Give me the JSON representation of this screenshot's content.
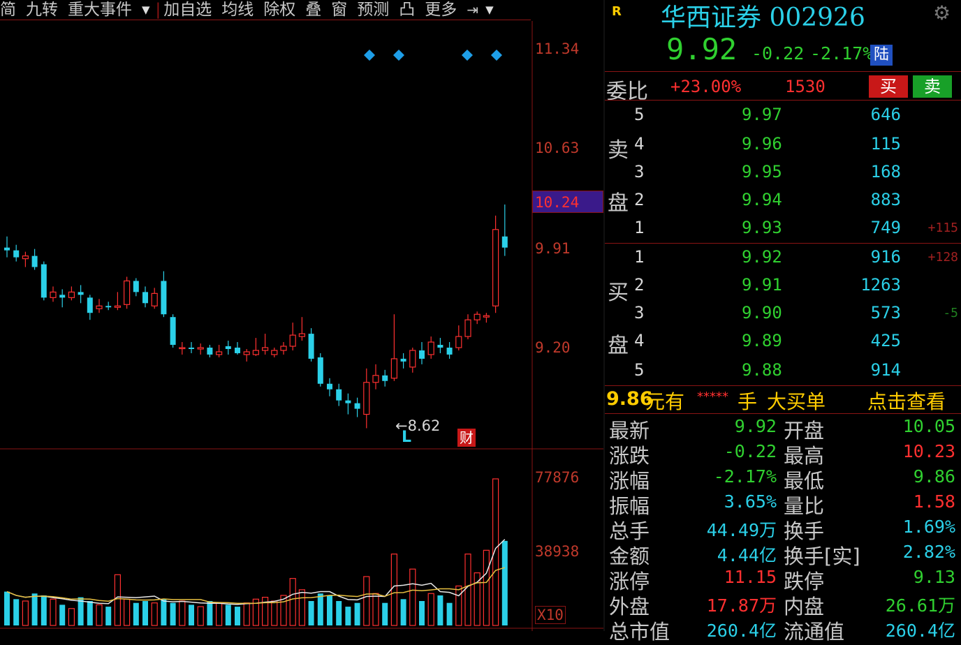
{
  "toolbar": {
    "items": [
      "简",
      "九转",
      "重大事件",
      "加自选",
      "均线",
      "除权",
      "叠",
      "窗",
      "预测",
      "凸",
      "更多"
    ]
  },
  "axis": {
    "price_ticks": [
      "11.34",
      "10.63",
      "9.91",
      "9.20"
    ],
    "highlight_price": "10.24",
    "volume_ticks": [
      "77876",
      "38938"
    ],
    "volume_unit": "X10"
  },
  "annotations": {
    "low_label": "←8.62",
    "low_marker": "L",
    "cai_marker": "财"
  },
  "colors": {
    "up": "#ff3030",
    "down": "#2bd0e8",
    "bg": "#000000",
    "accent": "#ffcc00"
  },
  "chart_data": {
    "type": "candlestick",
    "candles": [
      {
        "o": 9.92,
        "h": 10.0,
        "l": 9.85,
        "c": 9.9
      },
      {
        "o": 9.9,
        "h": 9.94,
        "l": 9.82,
        "c": 9.85
      },
      {
        "o": 9.84,
        "h": 9.89,
        "l": 9.78,
        "c": 9.86
      },
      {
        "o": 9.86,
        "h": 9.91,
        "l": 9.76,
        "c": 9.78
      },
      {
        "o": 9.8,
        "h": 9.82,
        "l": 9.54,
        "c": 9.56
      },
      {
        "o": 9.56,
        "h": 9.64,
        "l": 9.53,
        "c": 9.6
      },
      {
        "o": 9.58,
        "h": 9.62,
        "l": 9.49,
        "c": 9.56
      },
      {
        "o": 9.56,
        "h": 9.64,
        "l": 9.54,
        "c": 9.6
      },
      {
        "o": 9.6,
        "h": 9.65,
        "l": 9.52,
        "c": 9.58
      },
      {
        "o": 9.56,
        "h": 9.58,
        "l": 9.4,
        "c": 9.45
      },
      {
        "o": 9.48,
        "h": 9.55,
        "l": 9.45,
        "c": 9.5
      },
      {
        "o": 9.5,
        "h": 9.53,
        "l": 9.47,
        "c": 9.49
      },
      {
        "o": 9.49,
        "h": 9.6,
        "l": 9.47,
        "c": 9.5
      },
      {
        "o": 9.51,
        "h": 9.71,
        "l": 9.48,
        "c": 9.68
      },
      {
        "o": 9.68,
        "h": 9.7,
        "l": 9.57,
        "c": 9.6
      },
      {
        "o": 9.6,
        "h": 9.64,
        "l": 9.49,
        "c": 9.52
      },
      {
        "o": 9.5,
        "h": 9.63,
        "l": 9.48,
        "c": 9.59
      },
      {
        "o": 9.68,
        "h": 9.75,
        "l": 9.42,
        "c": 9.44
      },
      {
        "o": 9.42,
        "h": 9.44,
        "l": 9.2,
        "c": 9.22
      },
      {
        "o": 9.2,
        "h": 9.24,
        "l": 9.15,
        "c": 9.2
      },
      {
        "o": 9.2,
        "h": 9.24,
        "l": 9.16,
        "c": 9.19
      },
      {
        "o": 9.19,
        "h": 9.23,
        "l": 9.15,
        "c": 9.2
      },
      {
        "o": 9.2,
        "h": 9.22,
        "l": 9.13,
        "c": 9.15
      },
      {
        "o": 9.15,
        "h": 9.22,
        "l": 9.13,
        "c": 9.17
      },
      {
        "o": 9.21,
        "h": 9.25,
        "l": 9.15,
        "c": 9.19
      },
      {
        "o": 9.2,
        "h": 9.24,
        "l": 9.15,
        "c": 9.16
      },
      {
        "o": 9.15,
        "h": 9.19,
        "l": 9.1,
        "c": 9.17
      },
      {
        "o": 9.15,
        "h": 9.27,
        "l": 9.14,
        "c": 9.18
      },
      {
        "o": 9.18,
        "h": 9.3,
        "l": 9.15,
        "c": 9.2
      },
      {
        "o": 9.15,
        "h": 9.2,
        "l": 9.13,
        "c": 9.18
      },
      {
        "o": 9.18,
        "h": 9.24,
        "l": 9.15,
        "c": 9.21
      },
      {
        "o": 9.21,
        "h": 9.38,
        "l": 9.18,
        "c": 9.29
      },
      {
        "o": 9.28,
        "h": 9.42,
        "l": 9.25,
        "c": 9.3
      },
      {
        "o": 9.3,
        "h": 9.34,
        "l": 9.1,
        "c": 9.12
      },
      {
        "o": 9.13,
        "h": 9.16,
        "l": 8.92,
        "c": 8.94
      },
      {
        "o": 8.94,
        "h": 8.98,
        "l": 8.85,
        "c": 8.9
      },
      {
        "o": 8.9,
        "h": 8.94,
        "l": 8.78,
        "c": 8.82
      },
      {
        "o": 8.82,
        "h": 8.87,
        "l": 8.72,
        "c": 8.8
      },
      {
        "o": 8.8,
        "h": 8.84,
        "l": 8.7,
        "c": 8.76
      },
      {
        "o": 8.72,
        "h": 9.05,
        "l": 8.62,
        "c": 8.95
      },
      {
        "o": 8.95,
        "h": 9.08,
        "l": 8.9,
        "c": 9.0
      },
      {
        "o": 9.0,
        "h": 9.04,
        "l": 8.92,
        "c": 8.96
      },
      {
        "o": 8.98,
        "h": 9.44,
        "l": 8.96,
        "c": 9.12
      },
      {
        "o": 9.12,
        "h": 9.16,
        "l": 9.05,
        "c": 9.1
      },
      {
        "o": 9.06,
        "h": 9.2,
        "l": 9.02,
        "c": 9.18
      },
      {
        "o": 9.18,
        "h": 9.24,
        "l": 9.08,
        "c": 9.12
      },
      {
        "o": 9.15,
        "h": 9.28,
        "l": 9.12,
        "c": 9.24
      },
      {
        "o": 9.22,
        "h": 9.27,
        "l": 9.16,
        "c": 9.2
      },
      {
        "o": 9.2,
        "h": 9.24,
        "l": 9.12,
        "c": 9.15
      },
      {
        "o": 9.2,
        "h": 9.36,
        "l": 9.18,
        "c": 9.28
      },
      {
        "o": 9.28,
        "h": 9.44,
        "l": 9.26,
        "c": 9.4
      },
      {
        "o": 9.4,
        "h": 9.46,
        "l": 9.37,
        "c": 9.44
      },
      {
        "o": 9.42,
        "h": 9.45,
        "l": 9.38,
        "c": 9.43
      },
      {
        "o": 9.5,
        "h": 10.15,
        "l": 9.45,
        "c": 10.05
      },
      {
        "o": 10.0,
        "h": 10.23,
        "l": 9.86,
        "c": 9.92
      }
    ],
    "volumes": [
      18000,
      14000,
      13000,
      17000,
      16000,
      14000,
      11000,
      9000,
      15000,
      13000,
      11000,
      10000,
      27000,
      14000,
      12000,
      13000,
      12000,
      14000,
      12000,
      13000,
      11000,
      10000,
      13000,
      12000,
      11000,
      10000,
      12000,
      14000,
      15000,
      13000,
      16000,
      25000,
      19000,
      13000,
      17000,
      16000,
      13000,
      10000,
      12000,
      26000,
      17000,
      12000,
      38000,
      14000,
      30000,
      13000,
      17000,
      16000,
      12000,
      21000,
      38000,
      28000,
      40000,
      78000,
      45000
    ],
    "diamond_markers": 4
  },
  "quote": {
    "badge": "R",
    "name": "华西证券 002926",
    "price": "9.92",
    "change": "-0.22",
    "change_pct": "-2.17%",
    "market_badge": "陆"
  },
  "weibi": {
    "label": "委比",
    "pct": "+23.00%",
    "diff": "1530",
    "buy_label": "买",
    "sell_label": "卖"
  },
  "sell_side_label": [
    "卖",
    "盘"
  ],
  "buy_side_label": [
    "买",
    "盘"
  ],
  "asks": [
    {
      "level": "5",
      "price": "9.97",
      "vol": "646",
      "delta": ""
    },
    {
      "level": "4",
      "price": "9.96",
      "vol": "115",
      "delta": ""
    },
    {
      "level": "3",
      "price": "9.95",
      "vol": "168",
      "delta": ""
    },
    {
      "level": "2",
      "price": "9.94",
      "vol": "883",
      "delta": ""
    },
    {
      "level": "1",
      "price": "9.93",
      "vol": "749",
      "delta": "+115"
    }
  ],
  "bids": [
    {
      "level": "1",
      "price": "9.92",
      "vol": "916",
      "delta": "+128"
    },
    {
      "level": "2",
      "price": "9.91",
      "vol": "1263",
      "delta": ""
    },
    {
      "level": "3",
      "price": "9.90",
      "vol": "573",
      "delta": "-5"
    },
    {
      "level": "4",
      "price": "9.89",
      "vol": "425",
      "delta": ""
    },
    {
      "level": "5",
      "price": "9.88",
      "vol": "914",
      "delta": ""
    }
  ],
  "big_order": {
    "price": "9.86",
    "text1": "元有",
    "stars": "*****",
    "text2": "手",
    "text3": "大买单",
    "link": "点击查看"
  },
  "stats": [
    {
      "k1": "最新",
      "v1": "9.92",
      "c1": "green",
      "k2": "开盘",
      "v2": "10.05",
      "c2": "green"
    },
    {
      "k1": "涨跌",
      "v1": "-0.22",
      "c1": "green",
      "k2": "最高",
      "v2": "10.23",
      "c2": "red"
    },
    {
      "k1": "涨幅",
      "v1": "-2.17%",
      "c1": "green",
      "k2": "最低",
      "v2": "9.86",
      "c2": "green"
    },
    {
      "k1": "振幅",
      "v1": "3.65%",
      "c1": "cyan",
      "k2": "量比",
      "v2": "1.58",
      "c2": "red"
    },
    {
      "k1": "总手",
      "v1": "44.49万",
      "c1": "cyan",
      "k2": "换手",
      "v2": "1.69%",
      "c2": "cyan"
    },
    {
      "k1": "金额",
      "v1": "4.44亿",
      "c1": "cyan",
      "k2": "换手[实]",
      "v2": "2.82%",
      "c2": "cyan"
    },
    {
      "k1": "涨停",
      "v1": "11.15",
      "c1": "red",
      "k2": "跌停",
      "v2": "9.13",
      "c2": "green"
    },
    {
      "k1": "外盘",
      "v1": "17.87万",
      "c1": "red",
      "k2": "内盘",
      "v2": "26.61万",
      "c2": "green"
    },
    {
      "k1": "总市值",
      "v1": "260.4亿",
      "c1": "cyan",
      "k2": "流通值",
      "v2": "260.4亿",
      "c2": "cyan"
    }
  ]
}
